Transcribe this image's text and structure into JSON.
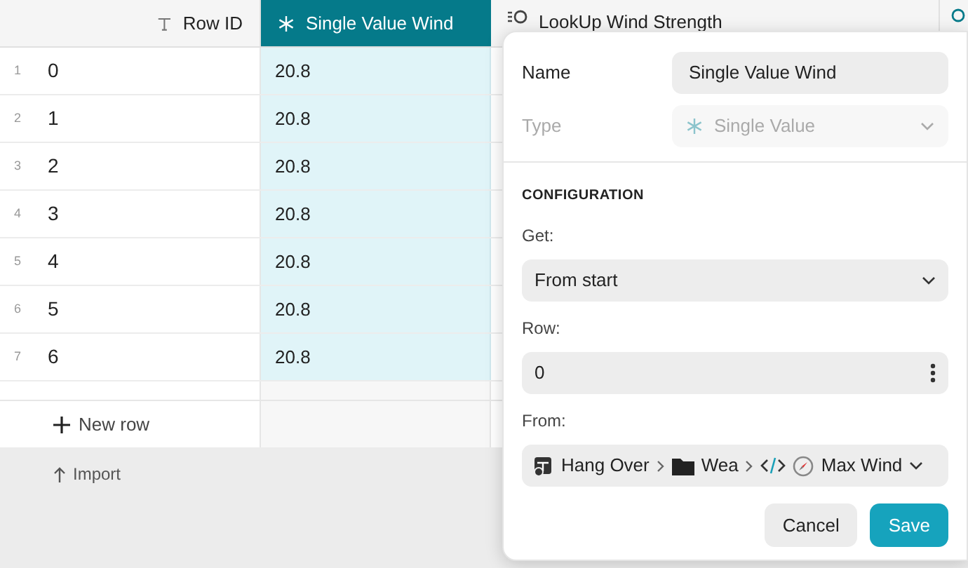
{
  "table": {
    "columns": [
      {
        "label": "Row ID",
        "kind": "text",
        "selected": false
      },
      {
        "label": "Single Value Wind",
        "kind": "single",
        "selected": true
      },
      {
        "label": "LookUp Wind Strength",
        "kind": "lookup",
        "selected": false
      }
    ],
    "rows": [
      {
        "number": "1",
        "cells": [
          "0",
          "20.8"
        ]
      },
      {
        "number": "2",
        "cells": [
          "1",
          "20.8"
        ]
      },
      {
        "number": "3",
        "cells": [
          "2",
          "20.8"
        ]
      },
      {
        "number": "4",
        "cells": [
          "3",
          "20.8"
        ]
      },
      {
        "number": "5",
        "cells": [
          "4",
          "20.8"
        ]
      },
      {
        "number": "6",
        "cells": [
          "5",
          "20.8"
        ]
      },
      {
        "number": "7",
        "cells": [
          "6",
          "20.8"
        ]
      }
    ],
    "new_row": "New row",
    "import": "Import"
  },
  "popover": {
    "name_label": "Name",
    "name_value": "Single Value Wind",
    "type_label": "Type",
    "type_value": "Single Value",
    "type_disabled": true,
    "section": "CONFIGURATION",
    "get_label": "Get:",
    "get_value": "From start",
    "row_label": "Row:",
    "row_value": "0",
    "from_label": "From:",
    "path": [
      {
        "kind": "table",
        "label": "Hang Over"
      },
      {
        "kind": "folder",
        "label": "Wea"
      },
      {
        "kind": "code"
      },
      {
        "kind": "compass",
        "label": "Max Wind"
      }
    ],
    "buttons": [
      {
        "label": "Cancel",
        "kind": "secondary"
      },
      {
        "label": "Save",
        "kind": "primary"
      }
    ]
  }
}
